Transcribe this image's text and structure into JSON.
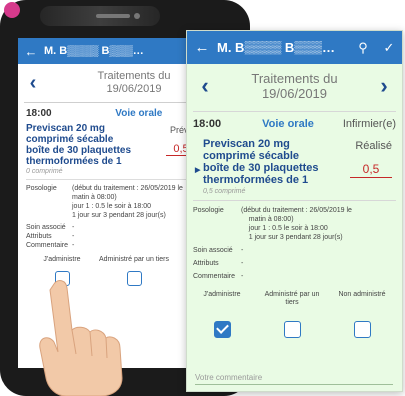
{
  "app": {
    "title_visible": "M. B",
    "title_ellipsis": "…",
    "header_icons": [
      "back-arrow",
      "search",
      "confirm"
    ]
  },
  "date_nav": {
    "line1": "Traitements du",
    "line2": "19/06/2019"
  },
  "administration": {
    "time": "18:00",
    "route": "Voie orale",
    "performer": "Infirmier(e)",
    "status_done": "Réalisé",
    "status_planned": "Prévu",
    "dose": "0,5",
    "drug_line1": "Previscan 20 mg",
    "drug_line2": "comprimé sécable",
    "drug_line3": "boîte de 30 plaquettes",
    "drug_line4": "thermoformées de 1",
    "dose_note_phone": "0 comprimé",
    "dose_note_card": "0,5 comprimé"
  },
  "details": {
    "posologie_label": "Posologie",
    "posologie_line1": "(début du traitement : 26/05/2019 le",
    "posologie_line2": "matin à 08:00)",
    "posologie_line3": "jour 1 : 0.5 le soir à 18:00",
    "posologie_line4": "1 jour sur 3 pendant 28 jour(s)",
    "soin_label": "Soin associé",
    "soin_value": "-",
    "attributs_label": "Attributs",
    "attributs_value": "-",
    "commentaire_label": "Commentaire",
    "commentaire_value": "-"
  },
  "choices": {
    "administered": "J'administre",
    "by_third": "Administré par un tiers",
    "not_administered": "Non administré",
    "not_administered_cut": "Non admin",
    "selected": "administered"
  },
  "comment": {
    "placeholder": "Votre commentaire"
  },
  "colors": {
    "primary": "#2f79c4",
    "card_bg": "#e9fbe4",
    "dose_red": "#c62828",
    "drug_blue": "#1f4b8e"
  }
}
